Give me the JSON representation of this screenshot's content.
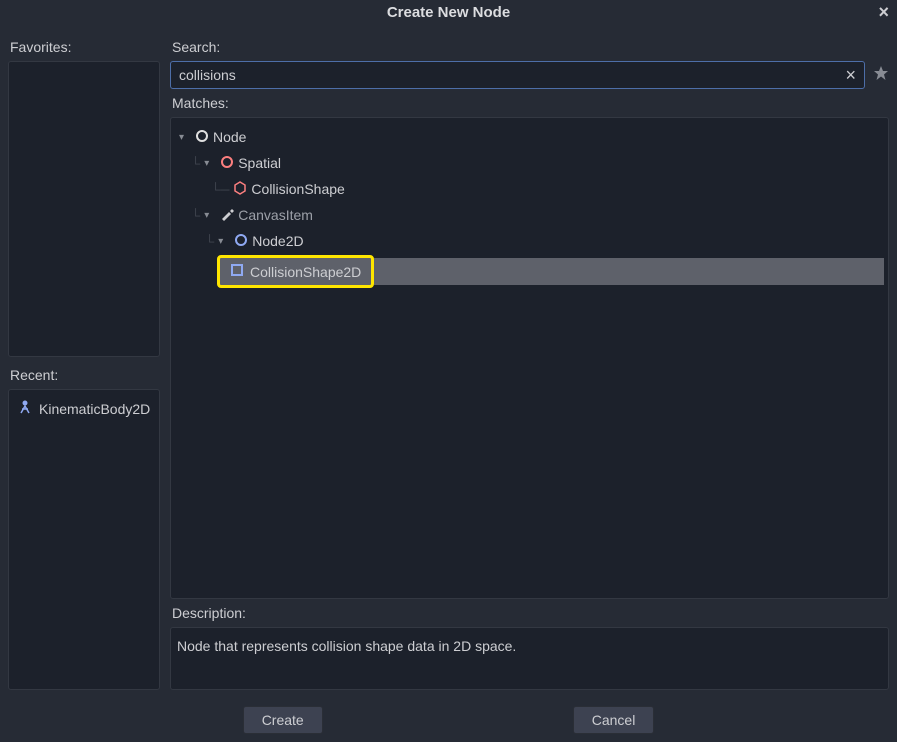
{
  "dialog": {
    "title": "Create New Node"
  },
  "left": {
    "favorites_label": "Favorites:",
    "recent_label": "Recent:",
    "recent_items": [
      {
        "label": "KinematicBody2D"
      }
    ]
  },
  "search": {
    "label": "Search:",
    "value": "collisions"
  },
  "matches": {
    "label": "Matches:",
    "tree": {
      "node": "Node",
      "spatial": "Spatial",
      "collision_shape": "CollisionShape",
      "canvas_item": "CanvasItem",
      "node2d": "Node2D",
      "collision_shape_2d": "CollisionShape2D"
    }
  },
  "description": {
    "label": "Description:",
    "text": "Node that represents collision shape data in 2D space."
  },
  "buttons": {
    "create": "Create",
    "cancel": "Cancel"
  }
}
